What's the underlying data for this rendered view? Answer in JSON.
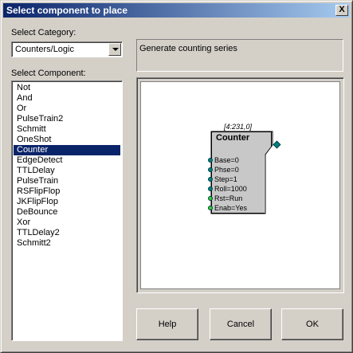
{
  "window": {
    "title": "Select component to place",
    "close_glyph": "X"
  },
  "category": {
    "label": "Select Category:",
    "value": "Counters/Logic"
  },
  "component": {
    "label": "Select Component:",
    "items": [
      "Not",
      "And",
      "Or",
      "PulseTrain2",
      "Schmitt",
      "OneShot",
      "Counter",
      "EdgeDetect",
      "TTLDelay",
      "PulseTrain",
      "RSFlipFlop",
      "JKFlipFlop",
      "DeBounce",
      "Xor",
      "TTLDelay2",
      "Schmitt2"
    ],
    "selected": "Counter"
  },
  "description": "Generate counting series",
  "preview": {
    "address": "[4:231,0]",
    "title": "Counter",
    "pins": [
      {
        "label": "Base=0",
        "color": "#008080"
      },
      {
        "label": "Phse=0",
        "color": "#008080"
      },
      {
        "label": "Step=1",
        "color": "#008080"
      },
      {
        "label": "Roll=1000",
        "color": "#008080"
      },
      {
        "label": "Rst=Run",
        "color": "#33cc33"
      },
      {
        "label": "Enab=Yes",
        "color": "#33cc33"
      }
    ]
  },
  "buttons": {
    "help": "Help",
    "cancel": "Cancel",
    "ok": "OK"
  }
}
